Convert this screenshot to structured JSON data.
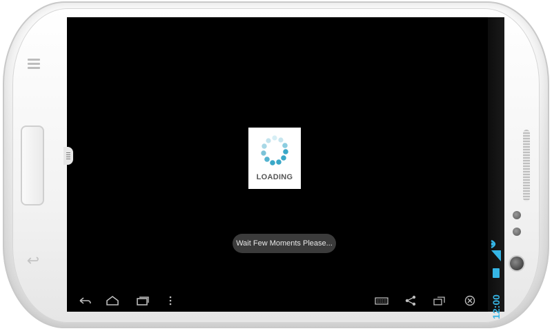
{
  "device": {
    "frame": "white-phone-landscape"
  },
  "loading": {
    "label": "LOADING",
    "spinner_color": "#3aa8c8"
  },
  "toast": {
    "message": "Wait Few Moments Please..."
  },
  "status_bar": {
    "time": "12:00",
    "accent_color": "#35b5e5"
  },
  "system_bar": {
    "nav_left": [
      "back-icon",
      "home-icon",
      "recent-apps-icon",
      "overflow-menu-icon"
    ],
    "nav_right": [
      "keyboard-icon",
      "share-icon",
      "screen-rotate-icon",
      "close-icon"
    ]
  }
}
